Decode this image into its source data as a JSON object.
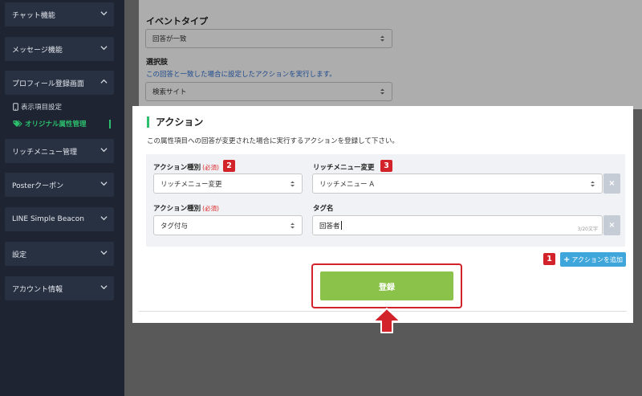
{
  "sidebar": {
    "items": [
      {
        "label": "チャット機能"
      },
      {
        "label": "メッセージ機能"
      },
      {
        "label": "プロフィール登録画面"
      },
      {
        "label": "リッチメニュー管理"
      },
      {
        "label": "Posterクーポン"
      },
      {
        "label": "LINE Simple Beacon"
      },
      {
        "label": "設定"
      },
      {
        "label": "アカウント情報"
      }
    ],
    "subitems": [
      {
        "label": "表示項目設定"
      },
      {
        "label": "オリジナル属性管理"
      }
    ]
  },
  "upper": {
    "event_type_label": "イベントタイプ",
    "event_type_value": "回答が一致",
    "choice_label": "選択肢",
    "choice_hint": "この回答と一致した場合に設定したアクションを実行します。",
    "choice_value": "検索サイト"
  },
  "panel": {
    "title": "アクション",
    "description": "この属性項目への回答が変更された場合に実行するアクションを登録して下さい。",
    "row1": {
      "left_label": "アクション種別",
      "required": "(必須)",
      "left_value": "リッチメニュー変更",
      "badge_left": "2",
      "right_label": "リッチメニュー変更",
      "right_value": "リッチメニュー A",
      "badge_right": "3"
    },
    "row2": {
      "left_label": "アクション種別",
      "required": "(必須)",
      "left_value": "タグ付与",
      "right_label": "タグ名",
      "right_value": "回答者",
      "counter": "3/20文字"
    },
    "remove_symbol": "×",
    "add_badge": "1",
    "add_plus": "+",
    "add_label": "アクションを追加",
    "submit_label": "登録"
  },
  "colors": {
    "accent_green": "#2cbf6e",
    "submit_green": "#8bc34a",
    "badge_red": "#d3232a",
    "add_blue": "#3fa6dc"
  }
}
